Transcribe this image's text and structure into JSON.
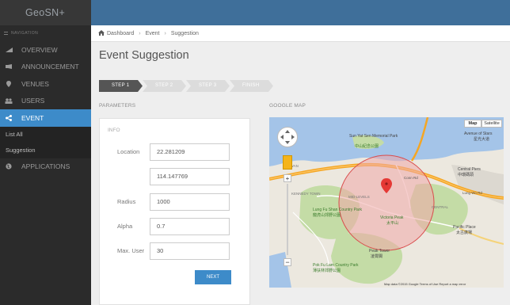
{
  "brand": "GeoSN+",
  "navigation": {
    "label": "NAVIGATION",
    "items": [
      {
        "label": "OVERVIEW",
        "icon": "bar-chart-icon"
      },
      {
        "label": "ANNOUNCEMENT",
        "icon": "megaphone-icon"
      },
      {
        "label": "VENUES",
        "icon": "map-pin-icon"
      },
      {
        "label": "USERS",
        "icon": "users-icon"
      },
      {
        "label": "EVENT",
        "icon": "share-icon",
        "active": true
      },
      {
        "label": "APPLICATIONS",
        "icon": "globe-icon"
      }
    ],
    "event_subitems": [
      "List All",
      "Suggestion"
    ]
  },
  "breadcrumb": {
    "items": [
      "Dashboard",
      "Event",
      "Suggestion"
    ]
  },
  "page_title": "Event Suggestion",
  "steps": [
    {
      "label": "STEP 1",
      "active": true
    },
    {
      "label": "STEP 2",
      "active": false
    },
    {
      "label": "STEP 3",
      "active": false
    },
    {
      "label": "FINISH",
      "active": false
    }
  ],
  "parameters_label": "PARAMETERS",
  "map_label": "GOOGLE MAP",
  "form": {
    "info_label": "INFO",
    "location_label": "Location",
    "latitude": "22.281209",
    "longitude": "114.147769",
    "radius_label": "Radius",
    "radius": "1000",
    "alpha_label": "Alpha",
    "alpha": "0.7",
    "max_user_label": "Max. User",
    "max_user": "30",
    "next_label": "NEXT"
  },
  "map": {
    "type_buttons": [
      "Map",
      "Satellite"
    ],
    "labels": {
      "park": "Sun Yat Sen Memorial Park",
      "park_zh": "中山紀念公園",
      "central_pier": "Central Piers",
      "central_pier_zh": "中環碼頭",
      "avenue": "Avenue of Stars",
      "avenue_zh": "星光大道",
      "victoria_peak": "Victoria Peak",
      "victoria_peak_zh": "太平山",
      "lung_fu": "Lung Fu Shan Country Park",
      "lung_fu_zh": "龍虎山郊野公園",
      "peak_tower": "Peak Tower",
      "peak_tower_zh": "凌霄閣",
      "pok_fu_lam": "Pok Fu Lam Country Park",
      "pok_fu_lam_zh": "薄扶林郊野公園",
      "pacific_place": "Pacific Place",
      "pacific_place_zh": "太古廣場",
      "mid_levels": "MID-LEVELS",
      "central": "CENTRAL",
      "sai_wan": "SAI WAN",
      "kennedy_town": "KENNEDY TOWN",
      "lung_wo": "Lung Wo Rd",
      "conn": "Conn Rd",
      "footer": "Map data ©2015 Google   Terms of Use   Report a map error"
    },
    "colors": {
      "circle_fill": "#f0a8a8",
      "circle_stroke": "#d94c4c",
      "marker": "#e53935",
      "water": "#a4c4e8",
      "land": "#ece8df",
      "park": "#c4dca6",
      "highway": "#f5a623"
    }
  },
  "colors": {
    "sidebar": "#2b2b2b",
    "topbar": "#3f6f9a",
    "accent": "#3d8bc9"
  }
}
